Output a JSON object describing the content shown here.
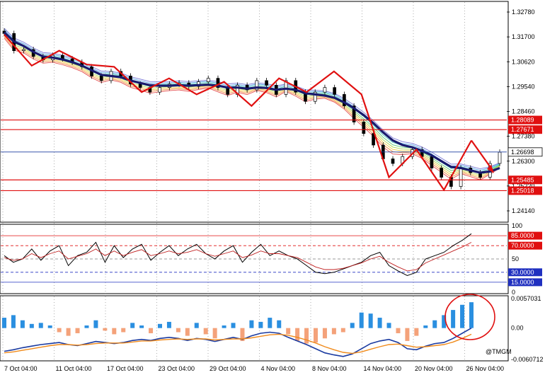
{
  "chart_data": {
    "type": "line",
    "main": {
      "y_ticks": [
        "1.32780",
        "1.31700",
        "1.30620",
        "1.29540",
        "1.28460",
        "1.27380",
        "1.26300",
        "1.25220",
        "1.24140"
      ],
      "ylim": [
        1.2371,
        1.3318
      ],
      "close": [
        1.3185,
        1.311,
        1.3115,
        1.3085,
        1.307,
        1.309,
        1.3075,
        1.306,
        1.304,
        1.3,
        1.298,
        1.302,
        1.3,
        1.2965,
        1.295,
        1.293,
        1.295,
        1.2965,
        1.297,
        1.2955,
        1.2975,
        1.299,
        1.295,
        1.292,
        1.296,
        1.294,
        1.298,
        1.296,
        1.292,
        1.298,
        1.293,
        1.289,
        1.293,
        1.295,
        1.292,
        1.287,
        1.28,
        1.275,
        1.27,
        1.264,
        1.262,
        1.265,
        1.268,
        1.265,
        1.26,
        1.256,
        1.252,
        1.26,
        1.258,
        1.256,
        1.262,
        1.2669
      ],
      "ema": [
        1.319,
        1.315,
        1.313,
        1.3105,
        1.3085,
        1.308,
        1.3072,
        1.306,
        1.3045,
        1.3025,
        1.3005,
        1.3,
        1.2995,
        1.298,
        1.297,
        1.296,
        1.2958,
        1.2958,
        1.296,
        1.2958,
        1.296,
        1.2962,
        1.2958,
        1.295,
        1.295,
        1.2945,
        1.295,
        1.2948,
        1.294,
        1.2945,
        1.294,
        1.2925,
        1.292,
        1.2915,
        1.2905,
        1.2885,
        1.286,
        1.283,
        1.2795,
        1.2755,
        1.272,
        1.27,
        1.269,
        1.2675,
        1.2655,
        1.263,
        1.2605,
        1.26,
        1.259,
        1.258,
        1.2585,
        1.26
      ],
      "zigzag": [
        1.318,
        1.3045,
        1.311,
        1.305,
        1.304,
        1.293,
        1.299,
        1.292,
        1.2975,
        1.287,
        1.299,
        1.293,
        1.302,
        1.292,
        1.256,
        1.268,
        1.2505,
        1.272
      ],
      "zigzag_projection": [
        1.272,
        1.259
      ],
      "hlines": [
        {
          "value": 1.28089,
          "label": "1.28089",
          "color": "#e01010",
          "badge": true
        },
        {
          "value": 1.27671,
          "label": "1.27671",
          "color": "#e01010",
          "badge": true
        },
        {
          "value": 1.26698,
          "label": "1.26698",
          "color": "#1f3fa0",
          "badge": false
        },
        {
          "value": 1.25485,
          "label": "1.25485",
          "color": "#e01010",
          "badge": true
        },
        {
          "value": 1.25018,
          "label": "1.25018",
          "color": "#e01010",
          "badge": true
        }
      ],
      "current_price": "1.26698"
    },
    "oscillator": {
      "ylim": [
        0,
        100
      ],
      "y_ticks": [
        "100",
        "85.0000",
        "70.0000",
        "50",
        "30.0000",
        "15.0000",
        "0"
      ],
      "level_values": [
        85,
        70,
        50,
        30,
        15
      ],
      "main_line": [
        55,
        45,
        50,
        65,
        48,
        62,
        70,
        40,
        55,
        60,
        75,
        45,
        70,
        52,
        65,
        72,
        48,
        60,
        70,
        55,
        65,
        72,
        58,
        50,
        62,
        70,
        45,
        60,
        72,
        55,
        62,
        55,
        50,
        40,
        30,
        28,
        30,
        35,
        40,
        45,
        55,
        60,
        40,
        32,
        25,
        30,
        50,
        55,
        60,
        70,
        78,
        88
      ],
      "signal_line": [
        52,
        48,
        50,
        58,
        52,
        58,
        62,
        50,
        54,
        58,
        65,
        55,
        62,
        55,
        60,
        64,
        55,
        58,
        62,
        58,
        60,
        64,
        58,
        54,
        58,
        62,
        52,
        56,
        62,
        58,
        58,
        55,
        52,
        45,
        38,
        34,
        34,
        36,
        40,
        44,
        50,
        54,
        45,
        38,
        32,
        34,
        44,
        50,
        56,
        62,
        68,
        75
      ]
    },
    "macd": {
      "y_ticks": [
        "0.0057031",
        "0.00",
        "-0.0060712"
      ],
      "ylim": [
        -0.0060712,
        0.0057031
      ],
      "histogram": [
        0.002,
        0.0025,
        0.0015,
        0.0008,
        0.001,
        0.0005,
        -0.0008,
        -0.0015,
        -0.001,
        0.0005,
        0.0015,
        -0.0005,
        -0.0012,
        -0.0008,
        0.001,
        0.0005,
        -0.001,
        0.0008,
        0.0012,
        -0.0008,
        -0.0015,
        0.001,
        -0.0012,
        -0.002,
        0.0005,
        0.001,
        -0.0025,
        0.0015,
        0.0012,
        0.002,
        0.0015,
        -0.0012,
        -0.0025,
        -0.003,
        -0.0028,
        -0.002,
        -0.0012,
        -0.0008,
        0.001,
        0.003,
        0.0028,
        0.002,
        0.001,
        -0.001,
        -0.0025,
        -0.0015,
        0.0005,
        0.0015,
        0.0025,
        0.0035,
        0.0045,
        0.005
      ],
      "macd_line": [
        -0.0045,
        -0.0042,
        -0.0038,
        -0.0035,
        -0.0032,
        -0.003,
        -0.0028,
        -0.0032,
        -0.0034,
        -0.003,
        -0.0026,
        -0.0028,
        -0.003,
        -0.0028,
        -0.0024,
        -0.0022,
        -0.0024,
        -0.002,
        -0.0018,
        -0.002,
        -0.0024,
        -0.002,
        -0.0022,
        -0.0026,
        -0.0022,
        -0.0018,
        -0.0022,
        -0.0015,
        -0.001,
        -0.0008,
        -0.001,
        -0.0018,
        -0.0025,
        -0.0032,
        -0.004,
        -0.0048,
        -0.0052,
        -0.0055,
        -0.005,
        -0.004,
        -0.003,
        -0.0025,
        -0.0022,
        -0.0028,
        -0.004,
        -0.0042,
        -0.0035,
        -0.003,
        -0.0028,
        -0.002,
        -0.001,
        0.0
      ],
      "signal_line": [
        -0.0048,
        -0.0046,
        -0.0043,
        -0.004,
        -0.0037,
        -0.0034,
        -0.0032,
        -0.0032,
        -0.0033,
        -0.0032,
        -0.003,
        -0.0029,
        -0.0029,
        -0.0029,
        -0.0027,
        -0.0025,
        -0.0025,
        -0.0023,
        -0.0022,
        -0.0021,
        -0.0022,
        -0.0021,
        -0.0021,
        -0.0023,
        -0.0022,
        -0.0021,
        -0.0021,
        -0.0019,
        -0.0016,
        -0.0013,
        -0.0012,
        -0.0014,
        -0.0018,
        -0.0023,
        -0.0029,
        -0.0036,
        -0.0042,
        -0.0047,
        -0.0049,
        -0.0046,
        -0.0041,
        -0.0036,
        -0.0032,
        -0.0031,
        -0.0034,
        -0.0037,
        -0.0036,
        -0.0034,
        -0.0032,
        -0.0027,
        -0.002,
        -0.0012
      ]
    },
    "x_tick_labels": [
      "7 Oct 04:00",
      "11 Oct 04:00",
      "17 Oct 04:00",
      "23 Oct 04:00",
      "29 Oct 04:00",
      "4 Nov 04:00",
      "8 Nov 04:00",
      "14 Nov 04:00",
      "20 Nov 04:00",
      "26 Nov 04:00"
    ]
  },
  "watermark": "@TMGM",
  "colors": {
    "zigzag": "#e01010",
    "ema_thick": "#1a1a6e",
    "price_line": "#000000",
    "level_line": "#e01010",
    "current_line": "#1f3fa0",
    "macd_pos": "#2a8fe0",
    "macd_neg": "#f4a27a",
    "macd_line": "#1a3aa0",
    "macd_signal": "#f08a1a",
    "osc_main": "#000000",
    "osc_signal": "#c02020",
    "highlight_circle": "#e01010"
  }
}
